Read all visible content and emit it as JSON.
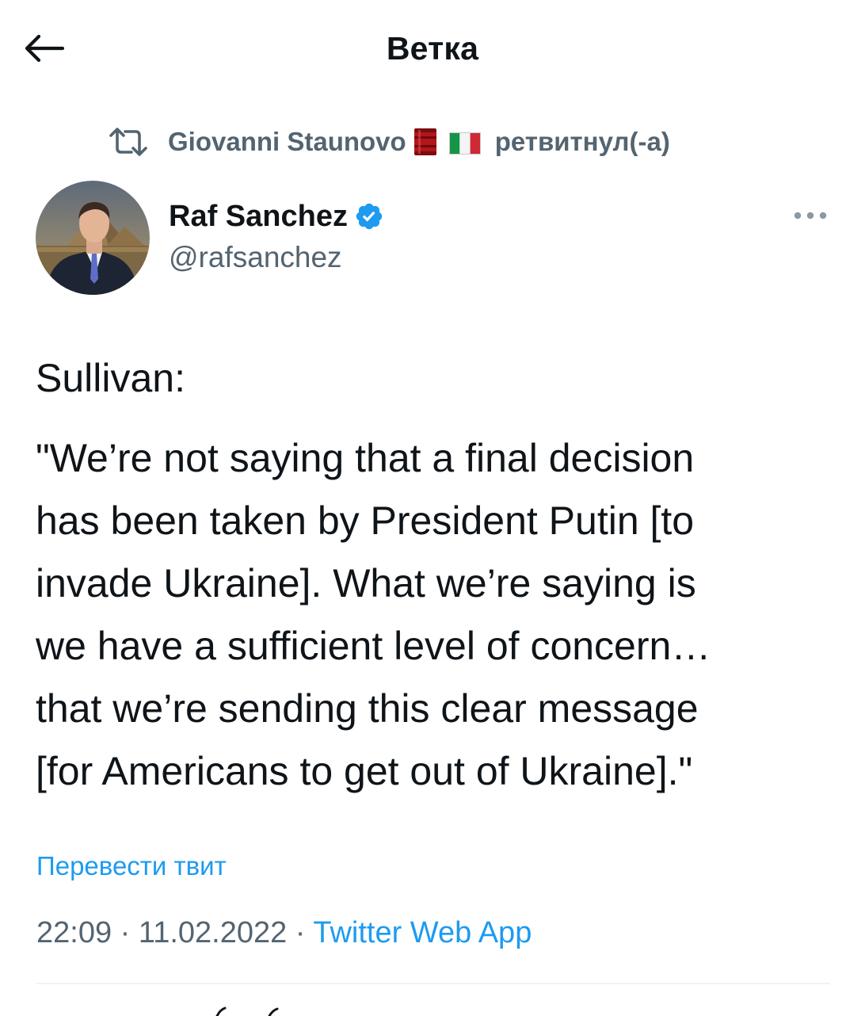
{
  "header": {
    "title": "Ветка",
    "back_icon": "arrow-left-icon"
  },
  "retweet": {
    "icon": "retweet-icon",
    "user": "Giovanni Staunovo",
    "emojis": [
      "oil-barrel",
      "italy-flag"
    ],
    "suffix": "ретвитнул(-а)"
  },
  "author": {
    "name": "Raf Sanchez",
    "handle": "@rafsanchez",
    "verified": true,
    "verified_color": "#1d9bf0"
  },
  "tweet": {
    "intro": "Sullivan:",
    "lines": [
      "\"We’re not saying that a final decision",
      "has been taken by President Putin [to",
      "invade Ukraine]. What we’re saying is",
      "we have a sufficient level of concern…",
      "that we’re sending this clear message",
      "[for Americans to get out of Ukraine].\""
    ]
  },
  "translate_label": "Перевести твит",
  "meta": {
    "time": "22:09",
    "separator": " · ",
    "date": "11.02.2022",
    "source": "Twitter Web App"
  },
  "colors": {
    "accent": "#1d9bf0",
    "secondary_text": "#536471",
    "primary_text": "#0f1419"
  }
}
